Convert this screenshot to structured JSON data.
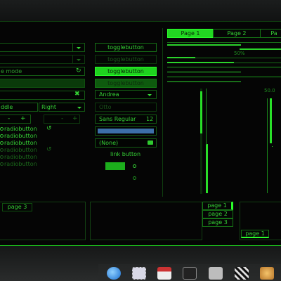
{
  "left": {
    "entry_mode_label": "e mode",
    "combo_align_1": "ddle",
    "combo_align_2": "Right",
    "minus": "-",
    "plus": "+",
    "minus2": "-",
    "plus2": "+",
    "radios": [
      "radiobutton",
      "radiobutton",
      "radiobutton",
      "radiobutton",
      "radiobutton",
      "radiobutton"
    ],
    "page3_tab": "page 3"
  },
  "middle": {
    "toggle1": "togglebutton",
    "toggle2": "togglebutton",
    "toggle3": "togglebutton",
    "toggle4": "togglebutton",
    "combo_name": "Andrea",
    "combo_disabled": "Otto",
    "font_button": "Sans Regular",
    "font_size": "12",
    "file_chooser": "(None)",
    "link_button": "link button"
  },
  "right": {
    "tabs": [
      "Page 1",
      "Page 2",
      "Pa"
    ],
    "progress_label": "50%",
    "scale_label": "50.0",
    "progress_value": 0.5
  },
  "bottom": {
    "page_tabs_vertical": [
      "page 1",
      "page 2",
      "page 3"
    ],
    "page_tab_bottom": "page 1"
  },
  "dock": {
    "icons": [
      "browser-icon",
      "mail-stamp-icon",
      "calendar-icon",
      "terminal-icon",
      "media-player-icon",
      "video-clapper-icon",
      "photo-icon"
    ]
  },
  "colors": {
    "accent": "#22d622",
    "background": "#050505"
  }
}
